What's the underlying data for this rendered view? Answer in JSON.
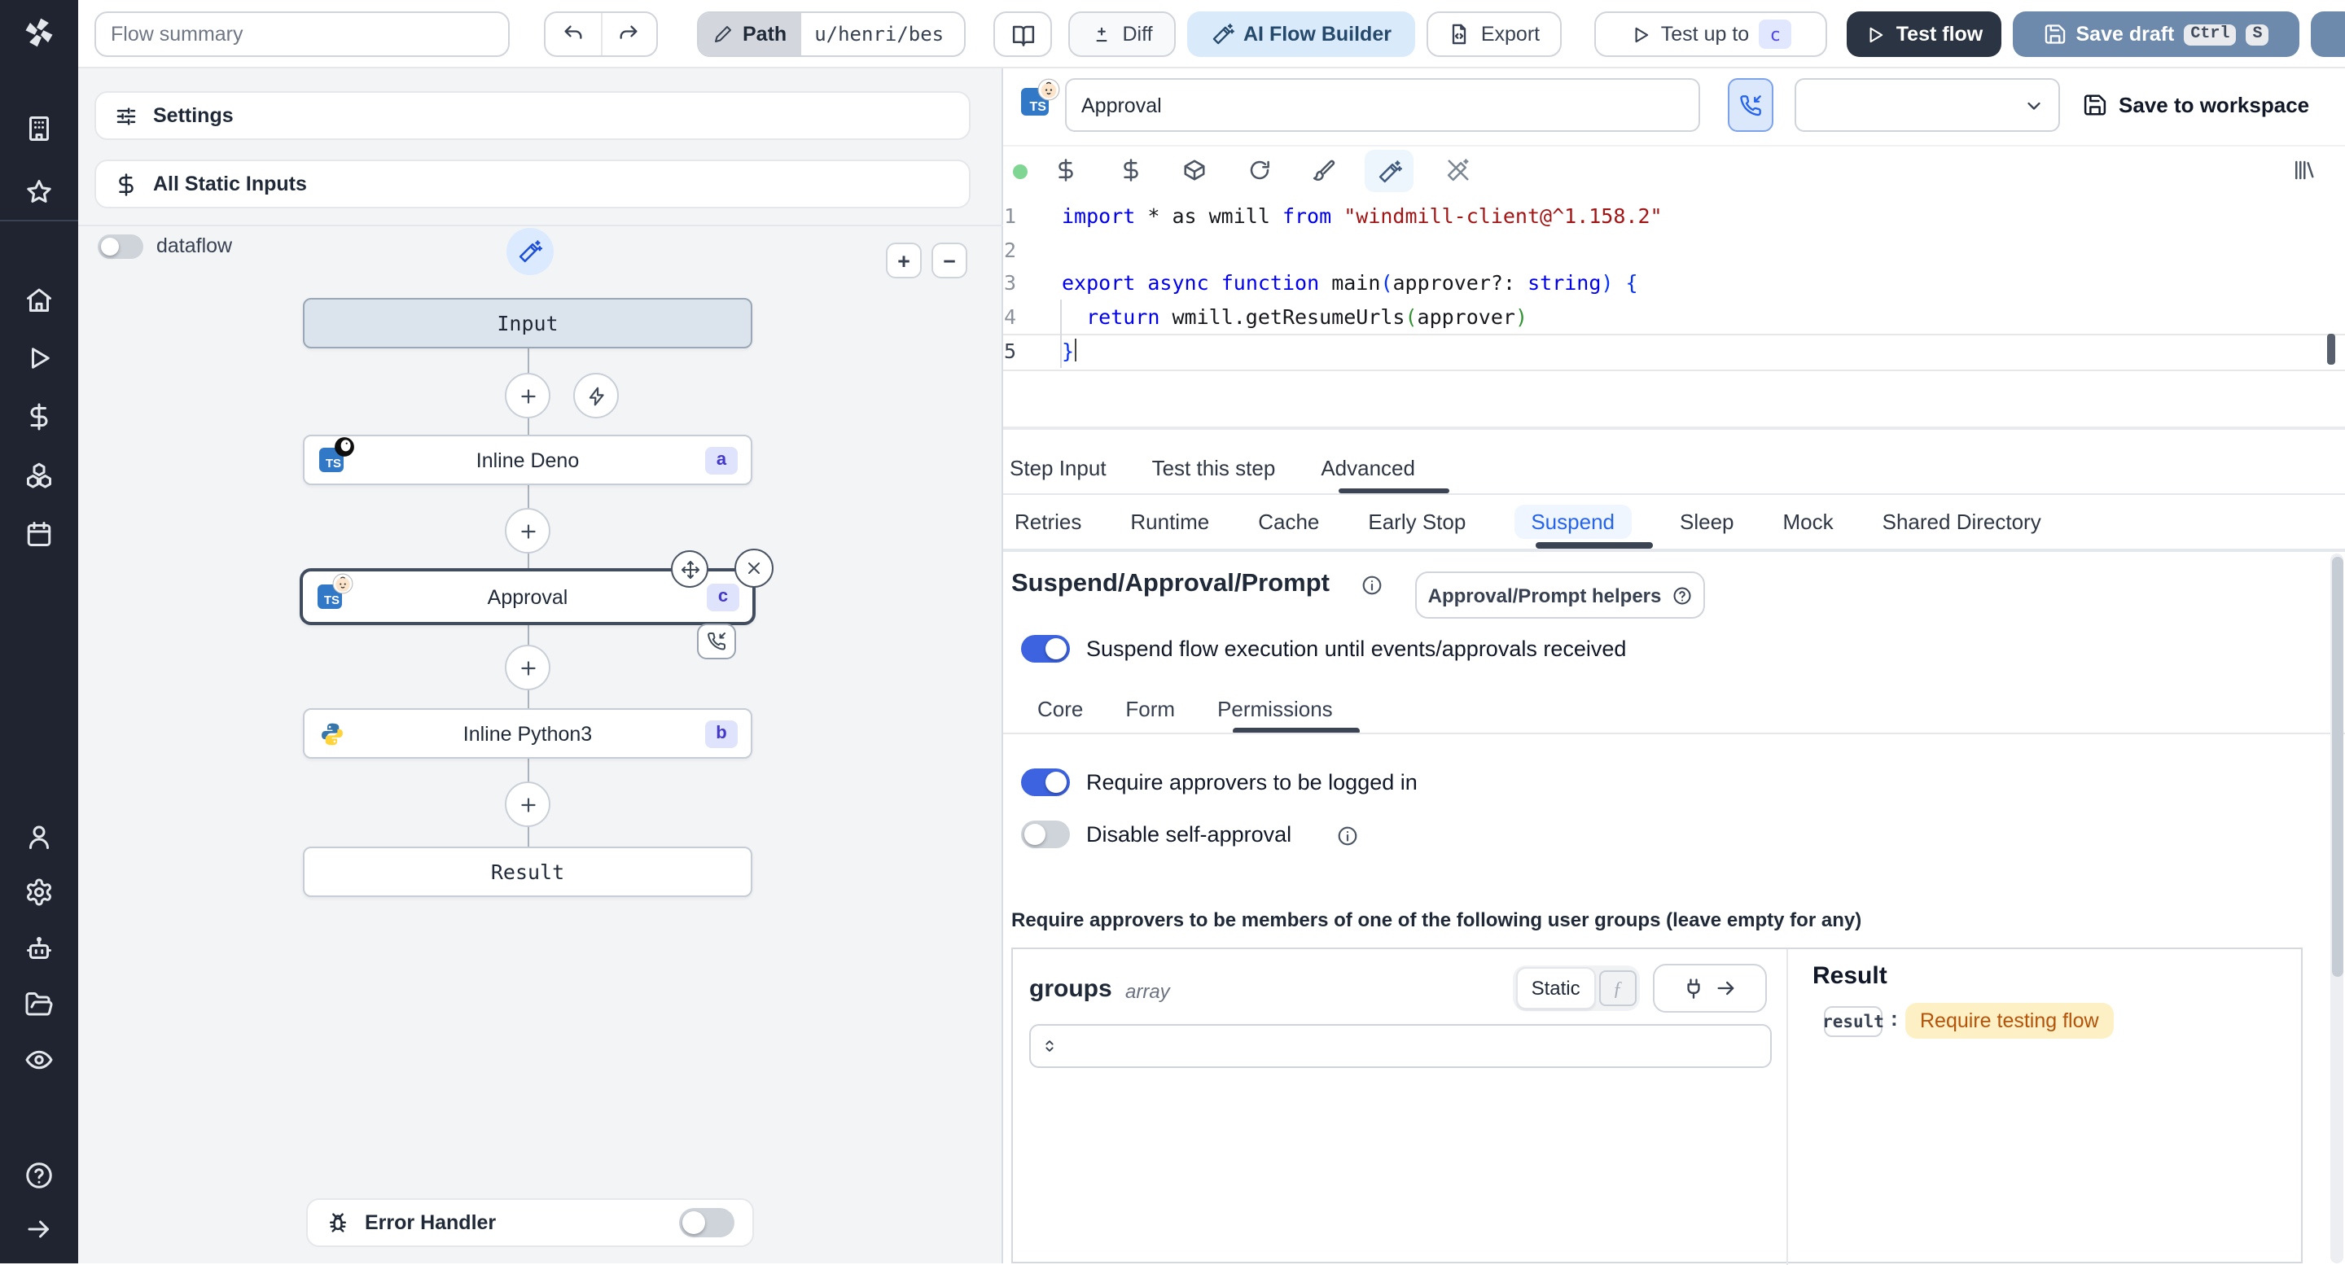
{
  "topbar": {
    "flow_summary_placeholder": "Flow summary",
    "path_label": "Path",
    "path_value": "u/henri/bes",
    "diff_label": "Diff",
    "ai_flow_builder_label": "AI Flow Builder",
    "export_label": "Export",
    "test_up_to_label": "Test up to",
    "test_up_to_badge": "c",
    "test_flow_label": "Test flow",
    "save_draft_label": "Save draft",
    "kbd_ctrl": "Ctrl",
    "kbd_s": "S"
  },
  "flow_panel": {
    "settings_label": "Settings",
    "static_inputs_label": "All Static Inputs",
    "dataflow_label": "dataflow",
    "zoom_in_glyph": "+",
    "zoom_out_glyph": "−",
    "nodes": {
      "input": {
        "label": "Input"
      },
      "deno": {
        "label": "Inline Deno",
        "badge": "a",
        "lang_badge": "TS"
      },
      "approval": {
        "label": "Approval",
        "badge": "c",
        "lang_badge": "TS"
      },
      "python": {
        "label": "Inline Python3",
        "badge": "b"
      },
      "result": {
        "label": "Result"
      }
    },
    "error_handler_label": "Error Handler"
  },
  "step_editor": {
    "name_value": "Approval",
    "lang_badge": "TS",
    "save_to_workspace_label": "Save to workspace",
    "code_lines": [
      {
        "n": "1",
        "tokens": [
          [
            "kw",
            "import"
          ],
          [
            "pl",
            " * as wmill "
          ],
          [
            "kw",
            "from"
          ],
          [
            "pl",
            " "
          ],
          [
            "str",
            "\"windmill-client@^1.158.2\""
          ]
        ]
      },
      {
        "n": "2",
        "tokens": []
      },
      {
        "n": "3",
        "tokens": [
          [
            "kw",
            "export"
          ],
          [
            "pl",
            " "
          ],
          [
            "kw",
            "async"
          ],
          [
            "pl",
            " "
          ],
          [
            "kw",
            "function"
          ],
          [
            "pl",
            " main"
          ],
          [
            "b1",
            "("
          ],
          [
            "pl",
            "approver?: "
          ],
          [
            "kw",
            "string"
          ],
          [
            "b1",
            ") {"
          ]
        ]
      },
      {
        "n": "4",
        "tokens": [
          [
            "pl",
            "  "
          ],
          [
            "kw",
            "return"
          ],
          [
            "pl",
            " wmill.getResumeUrls"
          ],
          [
            "b2",
            "("
          ],
          [
            "pl",
            "approver"
          ],
          [
            "b2",
            ")"
          ]
        ]
      },
      {
        "n": "5",
        "tokens": [
          [
            "b1",
            "}"
          ]
        ],
        "current": true
      }
    ]
  },
  "tabs": {
    "primary": [
      {
        "label": "Step Input",
        "active": false
      },
      {
        "label": "Test this step",
        "active": false
      },
      {
        "label": "Advanced",
        "active": true
      }
    ],
    "secondary": [
      {
        "label": "Retries"
      },
      {
        "label": "Runtime"
      },
      {
        "label": "Cache"
      },
      {
        "label": "Early Stop"
      },
      {
        "label": "Suspend",
        "active": true
      },
      {
        "label": "Sleep"
      },
      {
        "label": "Mock"
      },
      {
        "label": "Shared Directory"
      }
    ]
  },
  "suspend": {
    "heading": "Suspend/Approval/Prompt",
    "helpers_button_label": "Approval/Prompt helpers",
    "suspend_toggle_label": "Suspend flow execution until events/approvals received",
    "subtabs": [
      {
        "label": "Core"
      },
      {
        "label": "Form"
      },
      {
        "label": "Permissions",
        "active": true
      }
    ],
    "require_login_label": "Require approvers to be logged in",
    "disable_self_approval_label": "Disable self-approval",
    "groups_note": "Require approvers to be members of one of the following user groups (leave empty for any)",
    "groups_field": {
      "name": "groups",
      "type": "array",
      "static_label": "Static",
      "function_symbol": "ƒ"
    },
    "result_panel": {
      "heading": "Result",
      "key": "result",
      "colon": ":",
      "value": "Require testing flow"
    }
  },
  "toggles": {
    "dataflow": false,
    "error_handler": false,
    "suspend_execution": true,
    "require_login": true,
    "disable_self_approval": false
  },
  "colors": {
    "accent_toggle_on": "#3d63e0",
    "suspend_tab_text": "#2563eb",
    "suspend_tab_bg": "#eff6ff",
    "step_badge_bg": "#dfe3fb",
    "step_badge_text": "#4338ca",
    "test_flow_bg": "#2b3442",
    "save_draft_bg": "#6d89ab",
    "ai_builder_bg": "#d9eafb",
    "ai_builder_text": "#25496b",
    "result_value_bg": "#fdf0c5",
    "result_value_text": "#b45309",
    "status_dot": "#7fd693"
  },
  "icons": [
    "windmill-logo",
    "building",
    "star",
    "home",
    "play",
    "dollar",
    "boxes",
    "calendar",
    "user",
    "gear",
    "bot",
    "folder-open",
    "eye",
    "help-circle",
    "arrow-right",
    "undo",
    "redo",
    "pencil",
    "book-open",
    "diff-plus-minus",
    "wand-sparkles",
    "file-code",
    "save",
    "plus",
    "minus",
    "zap",
    "move",
    "close-x",
    "phone-incoming",
    "bug",
    "sliders",
    "rotate-cw",
    "paintbrush",
    "package",
    "library",
    "chevron-down",
    "info-circle",
    "plug",
    "chevrons-up-down",
    "function-f"
  ]
}
